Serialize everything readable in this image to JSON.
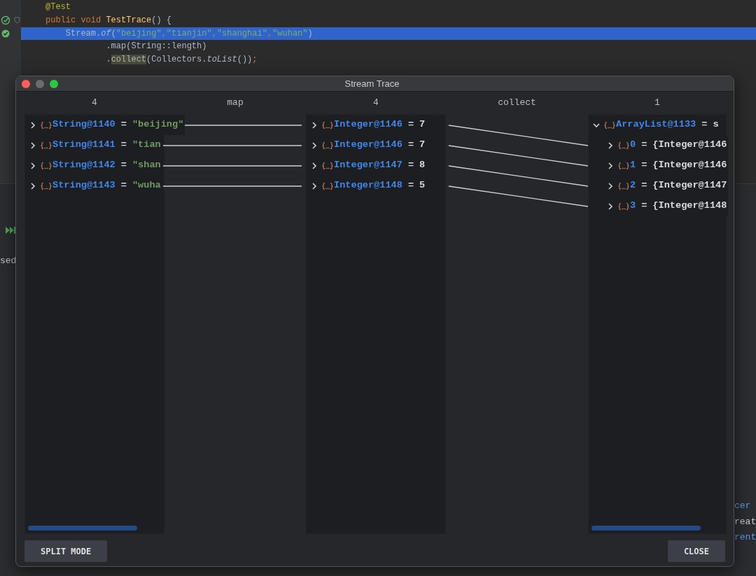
{
  "editor": {
    "lines": [
      {
        "kind": "code",
        "fold": false,
        "selected": false,
        "tokens": [
          {
            "text": "@Test",
            "kind": "annotation"
          }
        ]
      },
      {
        "kind": "test-method",
        "fold": true,
        "selected": false,
        "tokens": [
          {
            "text": "public void ",
            "kind": "keyword"
          },
          {
            "text": "TestTrace",
            "kind": "method"
          },
          {
            "text": "() {",
            "kind": "plain"
          }
        ]
      },
      {
        "kind": "test-passed",
        "fold": false,
        "selected": true,
        "tokens": [
          {
            "text": "    Stream.",
            "kind": "plain"
          },
          {
            "text": "of",
            "kind": "italic"
          },
          {
            "text": "(",
            "kind": "plain"
          },
          {
            "text": "\"beijing\"",
            "kind": "string"
          },
          {
            "text": ",",
            "kind": "keyword"
          },
          {
            "text": "\"tianjin\"",
            "kind": "string"
          },
          {
            "text": ",",
            "kind": "keyword"
          },
          {
            "text": "\"shanghai\"",
            "kind": "string"
          },
          {
            "text": ",",
            "kind": "keyword"
          },
          {
            "text": "\"wuhan\"",
            "kind": "string"
          },
          {
            "text": ")",
            "kind": "plain"
          }
        ]
      },
      {
        "kind": "code",
        "fold": false,
        "selected": false,
        "tokens": [
          {
            "text": "            .map(String::length)",
            "kind": "plain"
          }
        ]
      },
      {
        "kind": "code",
        "fold": false,
        "selected": false,
        "tokens": [
          {
            "text": "            .",
            "kind": "plain"
          },
          {
            "text": "collect",
            "kind": "highlighted"
          },
          {
            "text": "(Collectors.",
            "kind": "plain"
          },
          {
            "text": "toList",
            "kind": "italic"
          },
          {
            "text": "())",
            "kind": "plain"
          },
          {
            "text": ";",
            "kind": "keyword"
          }
        ]
      }
    ]
  },
  "background": {
    "left": [
      {
        "text": "sed",
        "kind": "plain"
      }
    ],
    "right": [
      {
        "text": "cer",
        "kind": "link"
      },
      {
        "text": "reat",
        "kind": "plain"
      },
      {
        "text": "rent",
        "kind": "link"
      }
    ]
  },
  "window": {
    "title": "Stream Trace",
    "columns": [
      {
        "kind": "values",
        "header": "4",
        "h_scroll": true,
        "items": [
          {
            "name": "String@1140",
            "equals": "=",
            "value": "\"beijing\"",
            "kind": "string",
            "expanded": false
          },
          {
            "name": "String@1141",
            "equals": "=",
            "value": "\"tian",
            "kind": "string",
            "expanded": false
          },
          {
            "name": "String@1142",
            "equals": "=",
            "value": "\"shan",
            "kind": "string",
            "expanded": false
          },
          {
            "name": "String@1143",
            "equals": "=",
            "value": "\"wuha",
            "kind": "string",
            "expanded": false
          }
        ]
      },
      {
        "kind": "map-lines",
        "header": "map"
      },
      {
        "kind": "values",
        "header": "4",
        "h_scroll": false,
        "items": [
          {
            "name": "Integer@1146",
            "equals": "=",
            "value": "7",
            "kind": "number",
            "expanded": false
          },
          {
            "name": "Integer@1146",
            "equals": "=",
            "value": "7",
            "kind": "number",
            "expanded": false
          },
          {
            "name": "Integer@1147",
            "equals": "=",
            "value": "8",
            "kind": "number",
            "expanded": false
          },
          {
            "name": "Integer@1148",
            "equals": "=",
            "value": "5",
            "kind": "number",
            "expanded": false
          }
        ]
      },
      {
        "kind": "collect-lines",
        "header": "collect"
      },
      {
        "kind": "values",
        "header": "1",
        "h_scroll": true,
        "items": [
          {
            "name": "ArrayList@1133",
            "equals": "=",
            "value": "s",
            "kind": "object",
            "expanded": true,
            "children": [
              {
                "name": "0",
                "equals": "=",
                "value": "{Integer@1146",
                "kind": "object",
                "expanded": false
              },
              {
                "name": "1",
                "equals": "=",
                "value": "{Integer@1146",
                "kind": "object",
                "expanded": false
              },
              {
                "name": "2",
                "equals": "=",
                "value": "{Integer@1147",
                "kind": "object",
                "expanded": false
              },
              {
                "name": "3",
                "equals": "=",
                "value": "{Integer@1148",
                "kind": "object",
                "expanded": false
              }
            ]
          }
        ]
      }
    ],
    "buttons": [
      {
        "label": "SPLIT MODE"
      },
      {
        "label": "CLOSE"
      }
    ]
  }
}
